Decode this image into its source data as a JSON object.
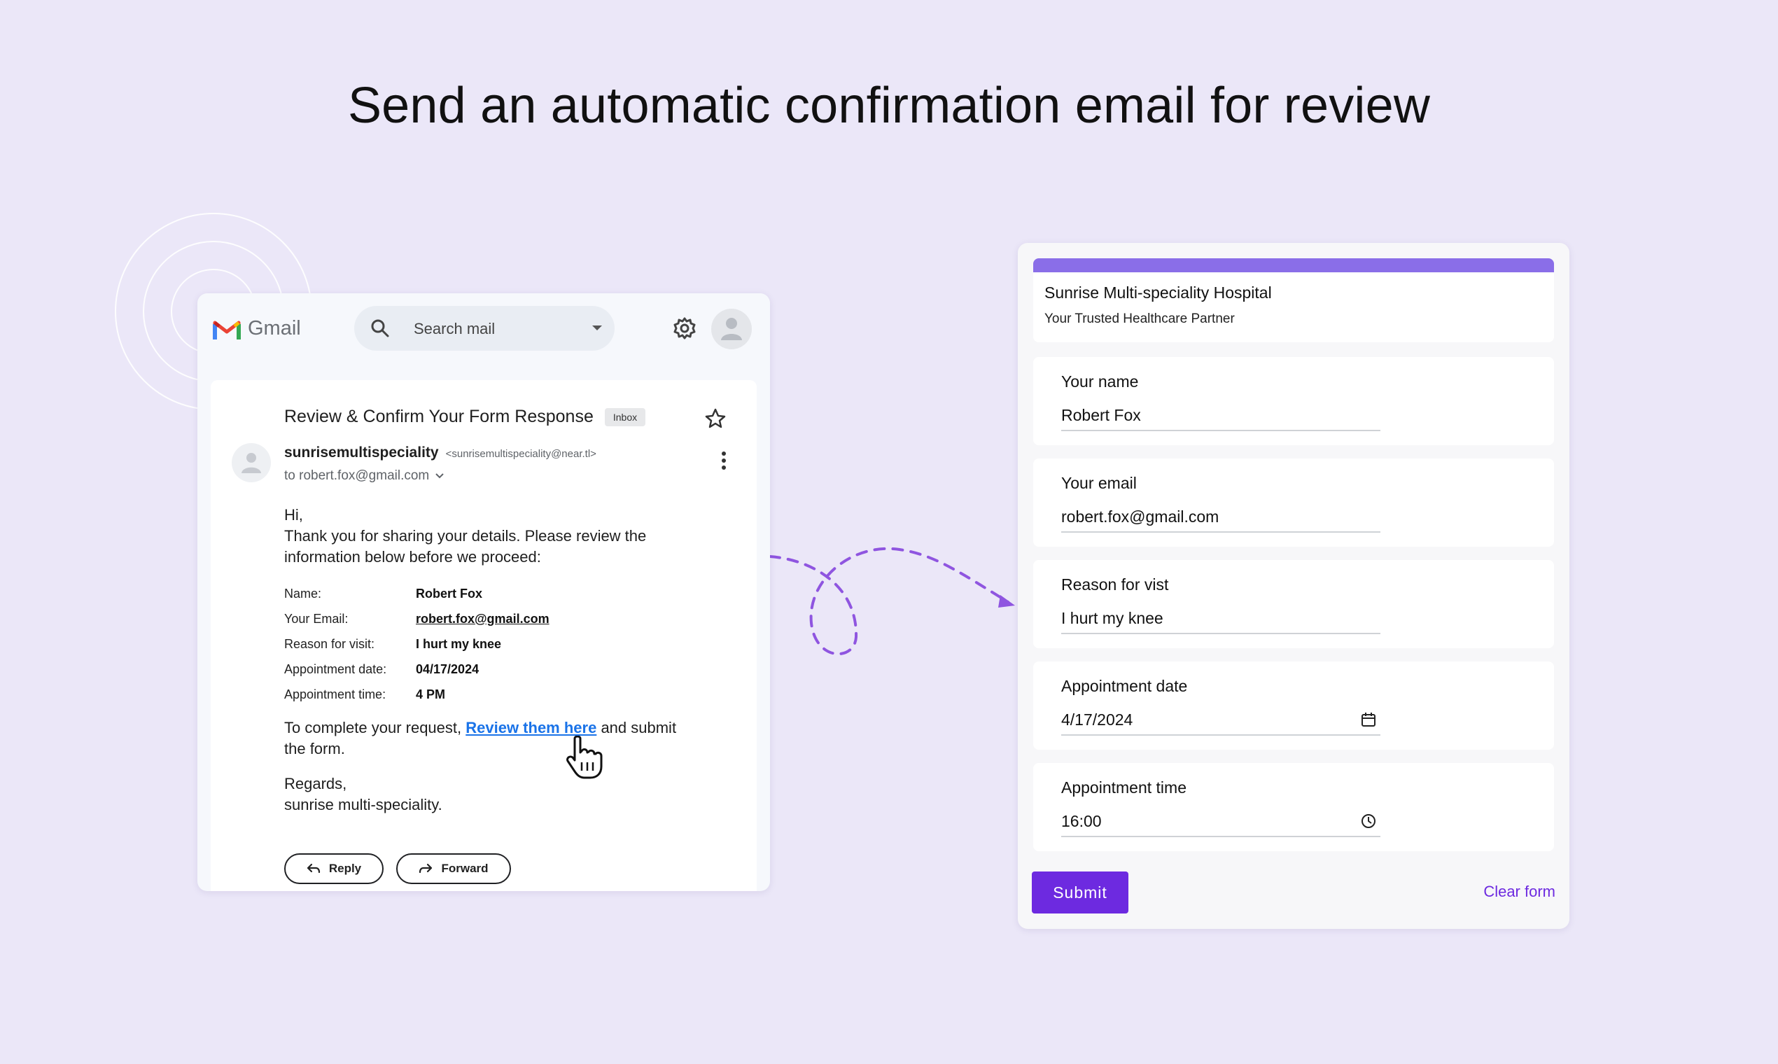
{
  "headline": "Send an automatic confirmation email for review",
  "gmail": {
    "app_name": "Gmail",
    "search_placeholder": "Search mail",
    "subject": "Review & Confirm Your Form Response",
    "badge": "Inbox",
    "sender_name": "sunrisemultispeciality",
    "sender_email": "<sunrisemultispeciality@near.tl>",
    "to": "to robert.fox@gmail.com",
    "greeting": "Hi,",
    "intro_line1": "Thank you for sharing your details. Please review the",
    "intro_line2": "information below before we proceed:",
    "details": [
      {
        "label": "Name:",
        "value": "Robert Fox"
      },
      {
        "label": "Your Email:",
        "value": "robert.fox@gmail.com"
      },
      {
        "label": "Reason for visit:",
        "value": "I hurt my knee"
      },
      {
        "label": "Appointment date:",
        "value": "04/17/2024"
      },
      {
        "label": "Appointment time:",
        "value": "4 PM"
      }
    ],
    "cta_before": "To complete your request, ",
    "cta_link": "Review them here",
    "cta_after": " and submit",
    "cta_line2": "the form.",
    "signoff": "Regards,",
    "signature": "sunrise multi-speciality.",
    "reply_label": "Reply",
    "forward_label": "Forward"
  },
  "form": {
    "title": "Sunrise Multi-speciality Hospital",
    "subtitle": "Your Trusted Healthcare Partner",
    "accent_color": "#8a6ee8",
    "fields": [
      {
        "label": "Your name",
        "value": "Robert Fox"
      },
      {
        "label": "Your email",
        "value": "robert.fox@gmail.com"
      },
      {
        "label": "Reason for vist",
        "value": "I hurt my knee"
      },
      {
        "label": "Appointment date",
        "value": "4/17/2024",
        "icon": "calendar-icon"
      },
      {
        "label": "Appointment time",
        "value": "16:00",
        "icon": "clock-icon"
      }
    ],
    "submit_label": "Submit",
    "clear_label": "Clear form",
    "button_color": "#6d2ae0"
  },
  "colors": {
    "background": "#ebe7f8",
    "link": "#1a73e8"
  }
}
